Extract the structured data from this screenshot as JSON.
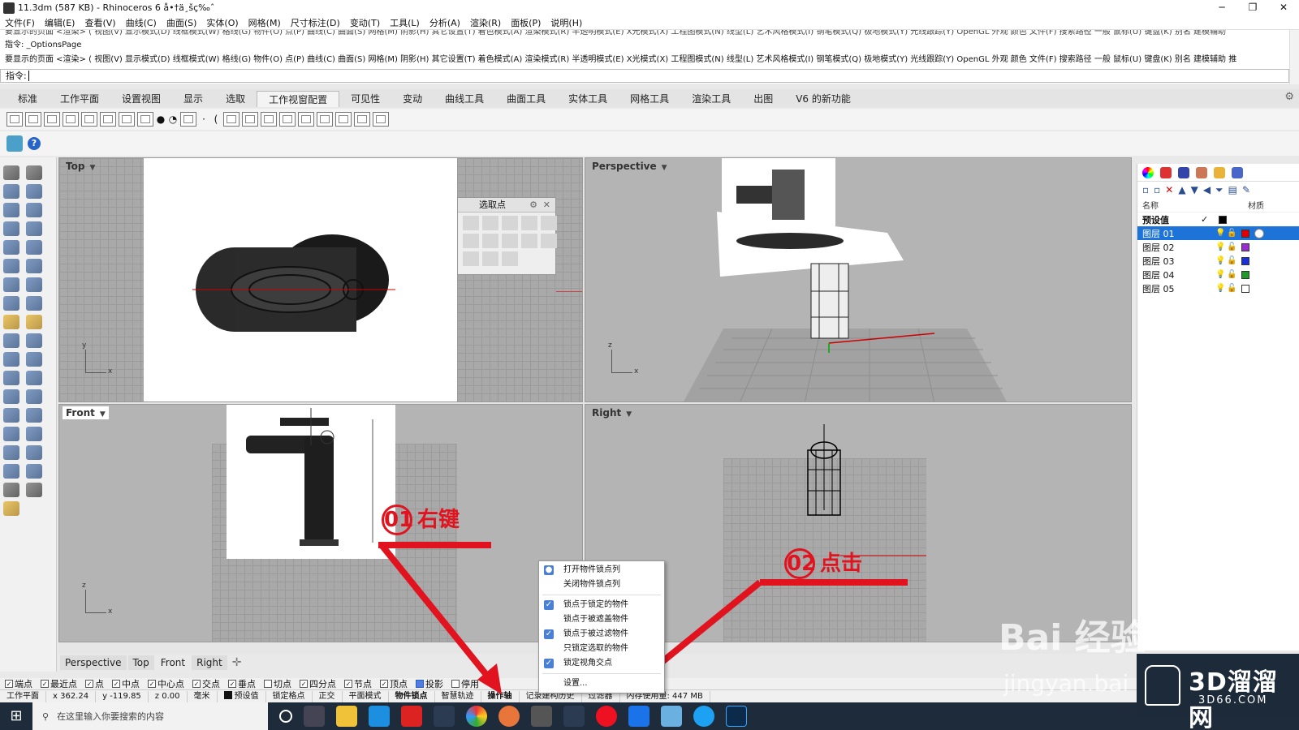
{
  "window": {
    "title": "11.3dm (587 KB) - Rhinoceros 6 å•†ä¸šç‰ˆ",
    "min": "─",
    "max": "❐",
    "close": "✕"
  },
  "menu": [
    "文件(F)",
    "编辑(E)",
    "查看(V)",
    "曲线(C)",
    "曲面(S)",
    "实体(O)",
    "网格(M)",
    "尺寸标注(D)",
    "变动(T)",
    "工具(L)",
    "分析(A)",
    "渲染(R)",
    "面板(P)",
    "说明(H)"
  ],
  "command": {
    "history_clipped": "要显示的页面 <渲染> ( 视图(V) 显示模式(D) 线框模式(W) 格线(G) 物件(O) 点(P) 曲线(C) 曲面(S) 网格(M) 阴影(H) 其它设置(T) 着色模式(A) 渲染模式(R) 半透明模式(E) X光模式(X) 工程图模式(N) 线型(L) 艺术风格模式(I) 钢笔模式(Q) 极地模式(Y) 光线跟踪(Y) OpenGL 外观 颜色 文件(F) 搜索路径 一般 鼠标(U) 键盘(K) 别名 建模辅助",
    "history_line": "指令: _OptionsPage",
    "history_line2": "要显示的页面 <渲染> ( 视图(V) 显示模式(D) 线框模式(W) 格线(G) 物件(O) 点(P) 曲线(C) 曲面(S) 网格(M) 阴影(H) 其它设置(T) 着色模式(A) 渲染模式(R) 半透明模式(E) X光模式(X) 工程图模式(N) 线型(L) 艺术风格模式(I) 钢笔模式(Q) 极地模式(Y) 光线跟踪(Y) OpenGL 外观 颜色 文件(F) 搜索路径 一般 鼠标(U) 键盘(K) 别名 建模辅助 推",
    "prompt": "指令:"
  },
  "tabs": [
    "标准",
    "工作平面",
    "设置视图",
    "显示",
    "选取",
    "工作视窗配置",
    "可见性",
    "变动",
    "曲线工具",
    "曲面工具",
    "实体工具",
    "网格工具",
    "渲染工具",
    "出图",
    "V6 的新功能"
  ],
  "active_tab": "工作视窗配置",
  "viewports": {
    "top": "Top",
    "perspective": "Perspective",
    "front": "Front",
    "right": "Right"
  },
  "axis_labels": {
    "x": "x",
    "y": "y",
    "z": "z"
  },
  "select_points_panel": {
    "title": "选取点"
  },
  "viewport_tabs": [
    "Perspective",
    "Top",
    "Front",
    "Right"
  ],
  "active_viewport_tab": "Front",
  "layers": {
    "col_name": "名称",
    "col_material": "材质",
    "default": "预设值",
    "rows": [
      {
        "name": "图层 01",
        "color": "#e00000",
        "selected": true
      },
      {
        "name": "图层 02",
        "color": "#9a2bd0",
        "selected": false
      },
      {
        "name": "图层 03",
        "color": "#1b2fd8",
        "selected": false
      },
      {
        "name": "图层 04",
        "color": "#1c9a2a",
        "selected": false
      },
      {
        "name": "图层 05",
        "color": "#ffffff",
        "selected": false
      }
    ]
  },
  "osnaps": [
    {
      "label": "端点",
      "checked": true
    },
    {
      "label": "最近点",
      "checked": true
    },
    {
      "label": "点",
      "checked": true
    },
    {
      "label": "中点",
      "checked": true
    },
    {
      "label": "中心点",
      "checked": true
    },
    {
      "label": "交点",
      "checked": true
    },
    {
      "label": "垂点",
      "checked": true
    },
    {
      "label": "切点",
      "checked": false
    },
    {
      "label": "四分点",
      "checked": true
    },
    {
      "label": "节点",
      "checked": true
    },
    {
      "label": "顶点",
      "checked": true
    },
    {
      "label": "投影",
      "checked": true
    },
    {
      "label": "停用",
      "checked": false
    }
  ],
  "status": {
    "cplane": "工作平面",
    "x": "x 362.24",
    "y": "y -119.85",
    "z": "z 0.00",
    "unit": "毫米",
    "layer": "预设值",
    "grid_snap": "锁定格点",
    "ortho": "正交",
    "planar": "平面模式",
    "osnap": "物件锁点",
    "smarttrack": "智慧轨迹",
    "gumball": "操作轴",
    "history": "记录建构历史",
    "filter": "过滤器",
    "memory": "内存使用量: 447 MB"
  },
  "context_menu": {
    "items": [
      {
        "label": "打开物件锁点列",
        "mark": "dot"
      },
      {
        "label": "关闭物件锁点列",
        "mark": ""
      },
      {
        "label": "锁点于锁定的物件",
        "mark": "check"
      },
      {
        "label": "锁点于被遮盖物件",
        "mark": ""
      },
      {
        "label": "锁点于被过滤物件",
        "mark": "check"
      },
      {
        "label": "只锁定选取的物件",
        "mark": ""
      },
      {
        "label": "锁定视角交点",
        "mark": "check"
      },
      {
        "label": "设置...",
        "mark": ""
      }
    ]
  },
  "annotations": {
    "step1_num": "01",
    "step1_text": "右键",
    "step2_num": "02",
    "step2_text": "点击"
  },
  "watermarks": {
    "baidu": "Bai 经验",
    "jingyan": "jingyan.bai",
    "brand_cn": "3D溜溜网",
    "brand_url": "3D66.COM"
  },
  "taskbar": {
    "search_placeholder": "在这里输入你要搜索的内容"
  },
  "colors": {
    "accent_red": "#e0131f",
    "selection_blue": "#1e73d8",
    "viewport_bg": "#b4b4b4"
  }
}
